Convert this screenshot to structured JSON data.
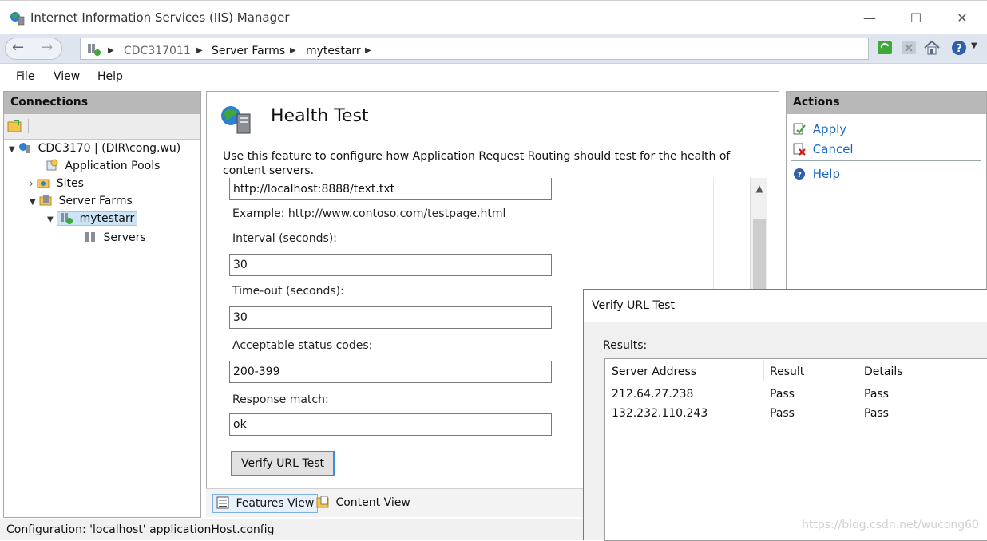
{
  "window": {
    "title": "Internet Information Services (IIS) Manager",
    "controls": {
      "minimize": "—",
      "maximize": "☐",
      "close": "✕"
    }
  },
  "addressbar": {
    "breadcrumbs": [
      "CDC317011",
      "Server Farms",
      "mytestarr"
    ]
  },
  "menu": {
    "file": {
      "accel": "F",
      "rest": "ile"
    },
    "view": {
      "accel": "V",
      "rest": "iew"
    },
    "help": {
      "accel": "H",
      "rest": "elp"
    }
  },
  "connections": {
    "header": "Connections",
    "tree": {
      "server": "CDC3170 | (DIR\\cong.wu)",
      "app_pools": "Application Pools",
      "sites": "Sites",
      "server_farms": "Server Farms",
      "farm": "mytestarr",
      "servers": "Servers"
    }
  },
  "main": {
    "title": "Health Test",
    "description": "Use this feature to configure how Application Request Routing should test for the health of content servers.",
    "url_value": "http://localhost:8888/text.txt",
    "example": "Example: http://www.contoso.com/testpage.html",
    "interval_label": "Interval (seconds):",
    "interval_value": "30",
    "timeout_label": "Time-out (seconds):",
    "timeout_value": "30",
    "status_codes_label": "Acceptable status codes:",
    "status_codes_value": "200-399",
    "response_match_label": "Response match:",
    "response_match_value": "ok",
    "verify_button": "Verify URL Test"
  },
  "viewtabs": {
    "features": "Features View",
    "content": "Content View"
  },
  "actions": {
    "header": "Actions",
    "apply": "Apply",
    "cancel": "Cancel",
    "help": "Help"
  },
  "status": {
    "text": "Configuration: 'localhost' applicationHost.config",
    "watermark": "https://blog.csdn.net/wucong60"
  },
  "dialog": {
    "title": "Verify URL Test",
    "results_label": "Results:",
    "columns": [
      "Server Address",
      "Result",
      "Details"
    ],
    "rows": [
      [
        "212.64.27.238",
        "Pass",
        "Pass"
      ],
      [
        "132.232.110.243",
        "Pass",
        "Pass"
      ]
    ]
  },
  "colors": {
    "accent": "#3c8fd6",
    "action_link": "#1a66c0",
    "pane_header": "#b8b8b8"
  }
}
